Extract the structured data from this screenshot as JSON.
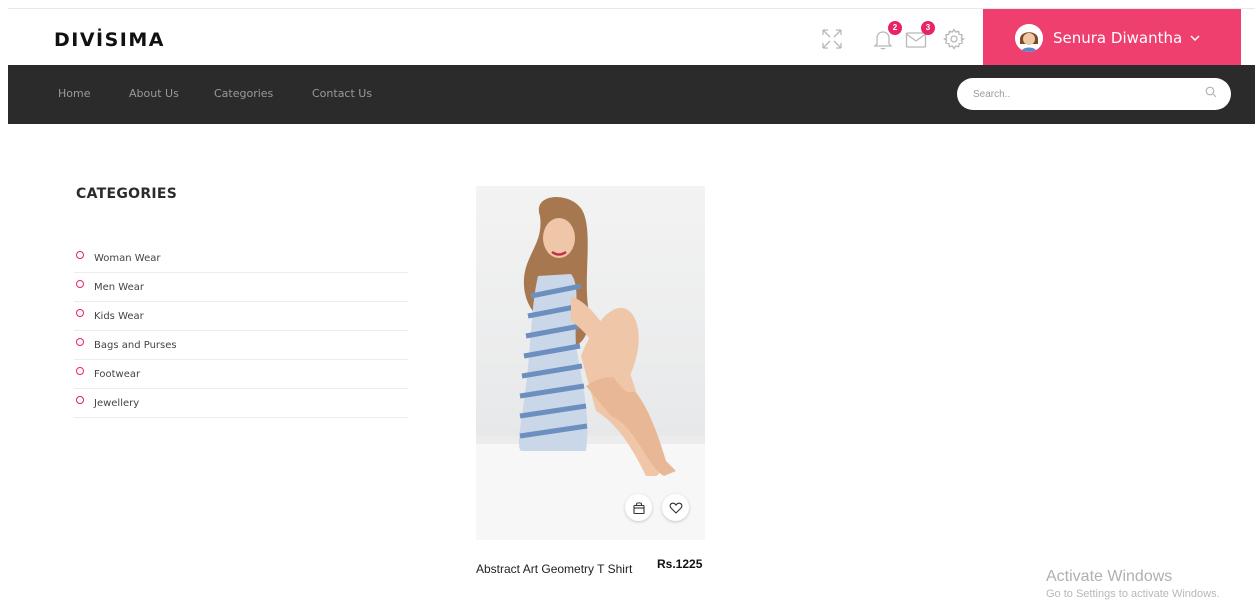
{
  "header": {
    "logo": "DIVİSIMA",
    "notifications_count": "2",
    "messages_count": "3",
    "user_name": "Senura Diwantha",
    "accent_color": "#ee3f6f",
    "icons": [
      "fullscreen-icon",
      "bell-icon",
      "mail-icon",
      "gear-icon",
      "chevron-down-icon"
    ]
  },
  "nav": {
    "items": [
      "Home",
      "About Us",
      "Categories",
      "Contact Us"
    ],
    "search_placeholder": "Search..",
    "background": "#2b2b2b"
  },
  "sidebar": {
    "title": "CATEGORIES",
    "items": [
      "Woman Wear",
      "Men Wear",
      "Kids Wear",
      "Bags and Purses",
      "Footwear",
      "Jewellery"
    ]
  },
  "product": {
    "name": "Abstract Art Geometry T Shirt",
    "price": "Rs.1225",
    "actions": [
      "shopping-bag-icon",
      "heart-icon"
    ]
  },
  "watermark": {
    "line1": "Activate Windows",
    "line2": "Go to Settings to activate Windows."
  }
}
